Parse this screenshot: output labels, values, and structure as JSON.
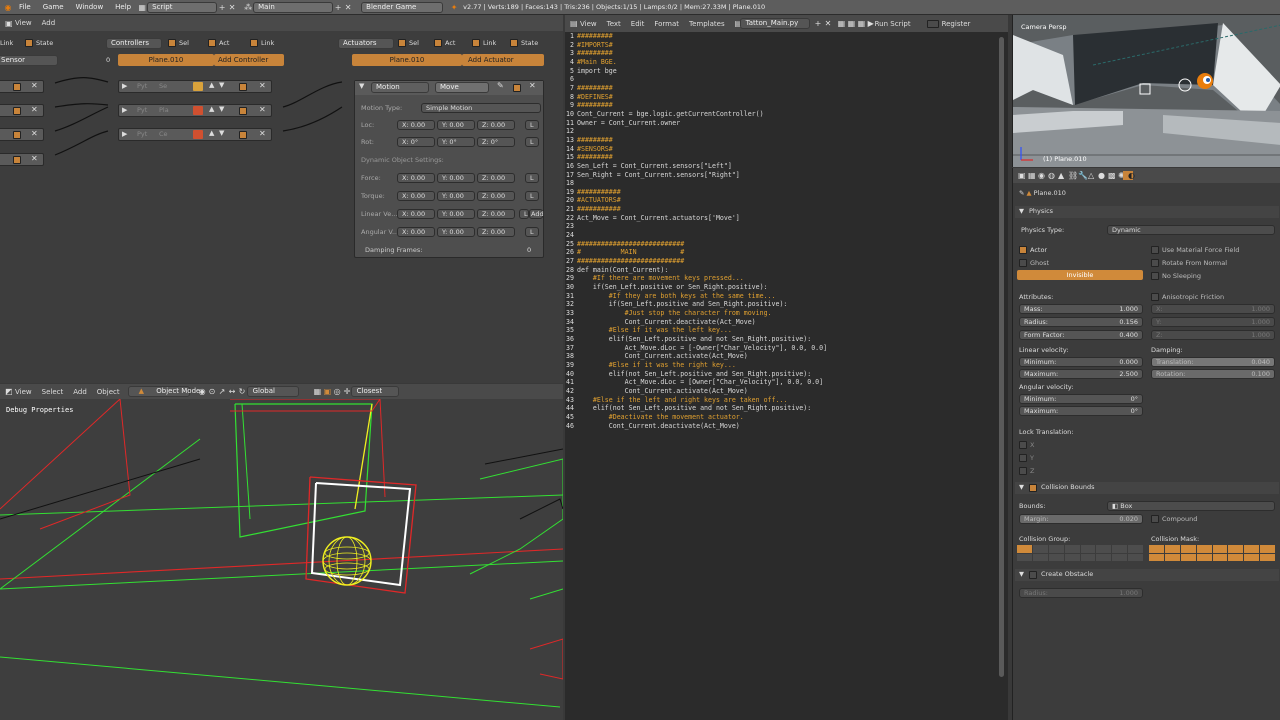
{
  "topbar": {
    "menus": [
      "File",
      "Game",
      "Window",
      "Help"
    ],
    "screen_layout": "Script",
    "scene": "Main",
    "engine": "Blender Game",
    "stats": "v2.77 | Verts:189 | Faces:143 | Tris:236 | Objects:1/15 | Lamps:0/2 | Mem:27.33M | Plane.010"
  },
  "logic": {
    "header_menus": [
      "View",
      "Add"
    ],
    "sensors_col": {
      "link": "Link",
      "state": "State",
      "dropdown": "Sensor"
    },
    "controllers_col": {
      "title": "Controllers",
      "sel": "Sel",
      "act": "Act",
      "link": "Link",
      "object": "Plane.010",
      "add": "Add Controller",
      "index": "0"
    },
    "controller_rows": [
      {
        "type": "Pyt",
        "name": "Se"
      },
      {
        "type": "Pyt",
        "name": "Pla"
      },
      {
        "type": "Pyt",
        "name": "Ce"
      }
    ],
    "actuators_col": {
      "title": "Actuators",
      "sel": "Sel",
      "act": "Act",
      "link": "Link",
      "state": "State",
      "object": "Plane.010",
      "add": "Add Actuator"
    },
    "motion": {
      "type": "Motion",
      "name": "Move",
      "motion_type_label": "Motion Type:",
      "motion_type": "Simple Motion",
      "loc_label": "Loc:",
      "loc": [
        "X: 0.00",
        "Y: 0.00",
        "Z: 0.00"
      ],
      "rot_label": "Rot:",
      "rot": [
        "X: 0°",
        "Y: 0°",
        "Z: 0°"
      ],
      "dyn_label": "Dynamic Object Settings:",
      "force_label": "Force:",
      "force": [
        "X: 0.00",
        "Y: 0.00",
        "Z: 0.00"
      ],
      "torque_label": "Torque:",
      "torque": [
        "X: 0.00",
        "Y: 0.00",
        "Z: 0.00"
      ],
      "linvel_label": "Linear Ve...",
      "linvel": [
        "X: 0.00",
        "Y: 0.00",
        "Z: 0.00"
      ],
      "angvel_label": "Angular V...",
      "angvel": [
        "X: 0.00",
        "Y: 0.00",
        "Z: 0.00"
      ],
      "l": "L",
      "add": "Add",
      "damping_label": "Damping Frames:",
      "damping": "0"
    }
  },
  "viewport": {
    "header_menus": [
      "View",
      "Select",
      "Add",
      "Object"
    ],
    "mode": "Object Mode",
    "orientation": "Global",
    "snap": "Closest",
    "overlay_text": "Debug Properties"
  },
  "text_editor": {
    "header_menus": [
      "View",
      "Text",
      "Edit",
      "Format",
      "Templates"
    ],
    "file": "Tatton_Main.py",
    "run": "Run Script",
    "register": "Register",
    "lines": [
      "#########",
      "#IMPORTS#",
      "#########",
      "#Main BGE.",
      "import bge",
      "",
      "#########",
      "#DEFINES#",
      "#########",
      "Cont_Current = bge.logic.getCurrentController()",
      "Owner = Cont_Current.owner",
      "",
      "#########",
      "#SENSORS#",
      "#########",
      "Sen_Left = Cont_Current.sensors[\"Left\"]",
      "Sen_Right = Cont_Current.sensors[\"Right\"]",
      "",
      "###########",
      "#ACTUATORS#",
      "###########",
      "Act_Move = Cont_Current.actuators['Move']",
      "",
      "",
      "###########################",
      "#          MAIN           #",
      "###########################",
      "def main(Cont_Current):",
      "    #If there are movement keys pressed...",
      "    if(Sen_Left.positive or Sen_Right.positive):",
      "        #If they are both keys at the same time...",
      "        if(Sen_Left.positive and Sen_Right.positive):",
      "            #Just stop the character from moving.",
      "            Cont_Current.deactivate(Act_Move)",
      "        #Else if it was the left key...",
      "        elif(Sen_Left.positive and not Sen_Right.positive):",
      "            Act_Move.dLoc = [-Owner[\"Char_Velocity\"], 0.0, 0.0]",
      "            Cont_Current.activate(Act_Move)",
      "        #Else if it was the right key...",
      "        elif(not Sen_Left.positive and Sen_Right.positive):",
      "            Act_Move.dLoc = [Owner[\"Char_Velocity\"], 0.0, 0.0]",
      "            Cont_Current.activate(Act_Move)",
      "    #Else if the left and right keys are taken off...",
      "    elif(not Sen_Left.positive and not Sen_Right.positive):",
      "        #Deactivate the movement actuator.",
      "        Cont_Current.deactivate(Act_Move)"
    ]
  },
  "camera_view": {
    "title": "Camera Persp",
    "object_label": "(1) Plane.010"
  },
  "properties": {
    "object": "Plane.010",
    "physics_panel": "Physics",
    "physics_type_label": "Physics Type:",
    "physics_type": "Dynamic",
    "actor": "Actor",
    "ghost": "Ghost",
    "invisible": "Invisible",
    "use_material_force": "Use Material Force Field",
    "rotate_from_normal": "Rotate From Normal",
    "no_sleeping": "No Sleeping",
    "attributes": "Attributes:",
    "anisotropic": "Anisotropic Friction",
    "mass_label": "Mass:",
    "mass": "1.000",
    "radius_label": "Radius:",
    "radius": "0.156",
    "form_label": "Form Factor:",
    "form": "0.400",
    "aniso_x": "X:",
    "aniso_y": "Y:",
    "aniso_z": "Z:",
    "aniso_val": "1.000",
    "linvel": "Linear velocity:",
    "min_label": "Minimum:",
    "max_label": "Maximum:",
    "lin_min": "0.000",
    "lin_max": "2.500",
    "damping": "Damping:",
    "trans_label": "Translation:",
    "trans": "0.040",
    "rot_label": "Rotation:",
    "rot": "0.100",
    "angvel": "Angular velocity:",
    "ang_min": "0°",
    "ang_max": "0°",
    "lock_trans": "Lock Translation:",
    "lock_axes": [
      "X",
      "Y",
      "Z"
    ],
    "collision_panel": "Collision Bounds",
    "bounds_label": "Bounds:",
    "bounds": "Box",
    "margin_label": "Margin:",
    "margin": "0.020",
    "compound": "Compound",
    "coll_group": "Collision Group:",
    "coll_mask": "Collision Mask:",
    "obstacle_panel": "Create Obstacle",
    "obstacle_radius_label": "Radius:",
    "obstacle_radius": "1.000"
  },
  "colors": {
    "accent": "#d08a3a",
    "code_comment": "#e0a030",
    "code_string": "#f0f0b0",
    "wire_green": "#33e033",
    "wire_red": "#e02828",
    "wire_yellow": "#f0f020"
  }
}
